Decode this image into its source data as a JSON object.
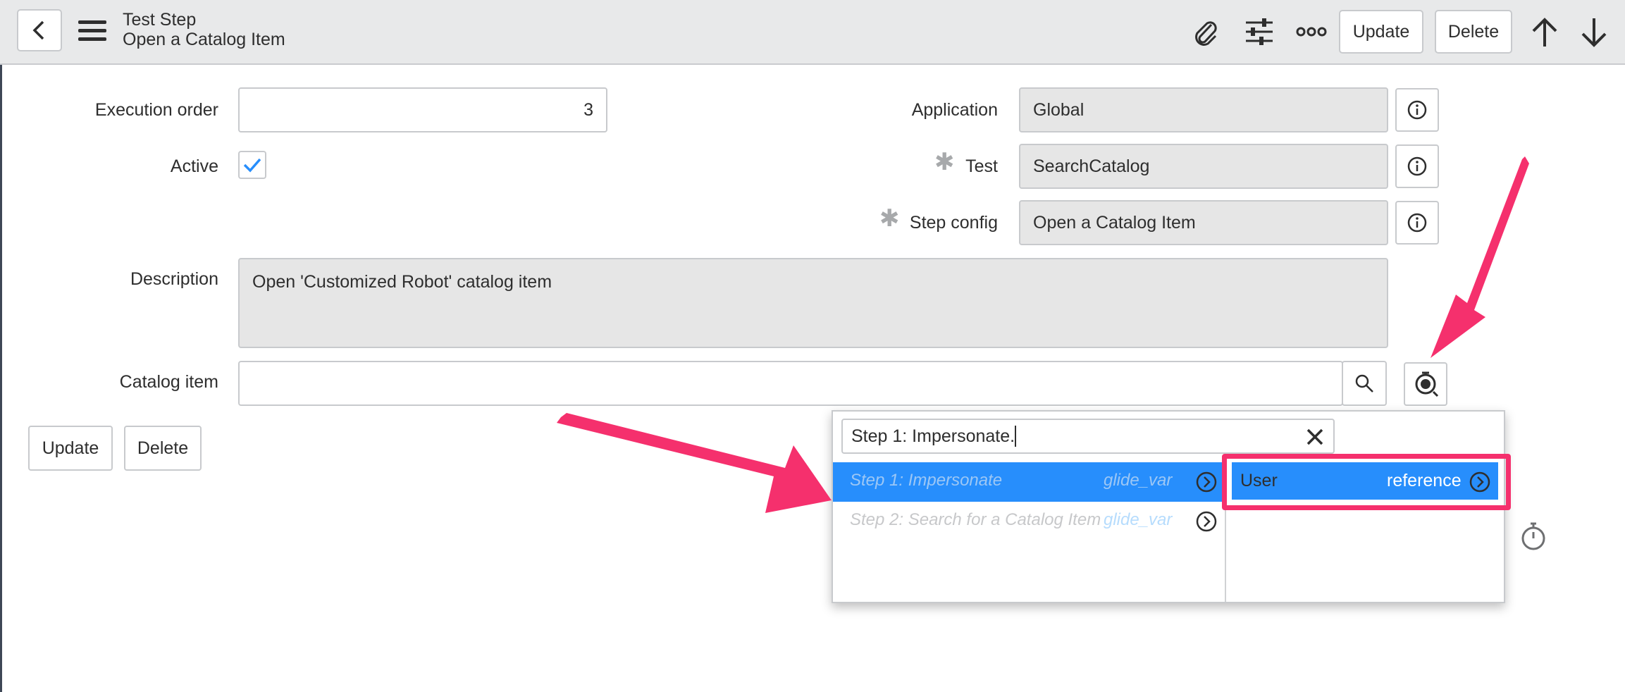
{
  "header": {
    "title": "Test Step",
    "subtitle": "Open a Catalog Item",
    "update_label": "Update",
    "delete_label": "Delete"
  },
  "form": {
    "execution_order": {
      "label": "Execution order",
      "value": "3"
    },
    "active": {
      "label": "Active",
      "checked": true
    },
    "application": {
      "label": "Application",
      "value": "Global"
    },
    "test": {
      "label": "Test",
      "value": "SearchCatalog"
    },
    "step_config": {
      "label": "Step config",
      "value": "Open a Catalog Item"
    },
    "description": {
      "label": "Description",
      "value": "Open 'Customized Robot' catalog item"
    },
    "catalog_item": {
      "label": "Catalog item",
      "value": ""
    },
    "update_label": "Update",
    "delete_label": "Delete"
  },
  "popup": {
    "search_value": "Step 1: Impersonate.",
    "items": [
      {
        "label": "Step 1: Impersonate",
        "type": "glide_var",
        "selected": true
      },
      {
        "label": "Step 2: Search for a Catalog Item",
        "type": "glide_var",
        "selected": false
      }
    ],
    "sub_items": [
      {
        "label": "User",
        "type": "reference",
        "selected": true
      }
    ]
  },
  "colors": {
    "accent": "#278efc",
    "annotation": "#f5306d",
    "header_bg": "#e8e9ea",
    "readonly_bg": "#e6e6e6"
  }
}
